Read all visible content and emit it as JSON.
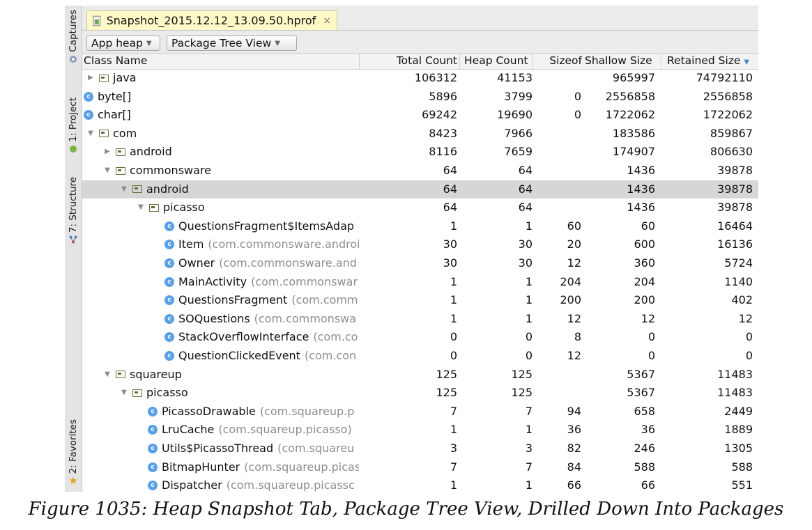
{
  "side_tabs": [
    {
      "label": "Captures",
      "icon": "captures-icon"
    },
    {
      "label": "1: Project",
      "icon": "android-icon"
    },
    {
      "label": "7: Structure",
      "icon": "structure-icon"
    },
    {
      "label": "2: Favorites",
      "icon": "star-icon"
    }
  ],
  "tab": {
    "title": "Snapshot_2015.12.12_13.09.50.hprof",
    "close": "×",
    "icon": "hprof-file-icon"
  },
  "toolbar": {
    "heap_select": "App heap",
    "view_select": "Package Tree View"
  },
  "columns": {
    "class_name": "Class Name",
    "total_count": "Total Count",
    "heap_count": "Heap Count",
    "sizeof": "Sizeof",
    "shallow_size": "Shallow Size",
    "retained_size": "Retained Size"
  },
  "rows": [
    {
      "name": "java",
      "pkg": "",
      "type": "package",
      "expander": "collapsed",
      "total": "106312",
      "heap": "41153",
      "sizeof": "",
      "shallow": "965997",
      "retained": "74792110"
    },
    {
      "name": "byte[]",
      "pkg": "",
      "type": "class",
      "expander": "none",
      "total": "5896",
      "heap": "3799",
      "sizeof": "0",
      "shallow": "2556858",
      "retained": "2556858"
    },
    {
      "name": "char[]",
      "pkg": "",
      "type": "class",
      "expander": "none",
      "total": "69242",
      "heap": "19690",
      "sizeof": "0",
      "shallow": "1722062",
      "retained": "1722062"
    },
    {
      "name": "com",
      "pkg": "",
      "type": "package",
      "expander": "expanded",
      "total": "8423",
      "heap": "7966",
      "sizeof": "",
      "shallow": "183586",
      "retained": "859867"
    },
    {
      "name": "android",
      "pkg": "",
      "type": "package",
      "expander": "collapsed",
      "total": "8116",
      "heap": "7659",
      "sizeof": "",
      "shallow": "174907",
      "retained": "806630"
    },
    {
      "name": "commonsware",
      "pkg": "",
      "type": "package",
      "expander": "expanded",
      "total": "64",
      "heap": "64",
      "sizeof": "",
      "shallow": "1436",
      "retained": "39878"
    },
    {
      "name": "android",
      "pkg": "",
      "type": "package",
      "expander": "expanded",
      "total": "64",
      "heap": "64",
      "sizeof": "",
      "shallow": "1436",
      "retained": "39878",
      "selected": true
    },
    {
      "name": "picasso",
      "pkg": "",
      "type": "package",
      "expander": "expanded",
      "total": "64",
      "heap": "64",
      "sizeof": "",
      "shallow": "1436",
      "retained": "39878"
    },
    {
      "name": "QuestionsFragment$ItemsAdap",
      "pkg": "",
      "type": "class",
      "expander": "none",
      "total": "1",
      "heap": "1",
      "sizeof": "60",
      "shallow": "60",
      "retained": "16464"
    },
    {
      "name": "Item",
      "pkg": "(com.commonsware.androi",
      "type": "class",
      "expander": "none",
      "total": "30",
      "heap": "30",
      "sizeof": "20",
      "shallow": "600",
      "retained": "16136"
    },
    {
      "name": "Owner",
      "pkg": "(com.commonsware.and",
      "type": "class",
      "expander": "none",
      "total": "30",
      "heap": "30",
      "sizeof": "12",
      "shallow": "360",
      "retained": "5724"
    },
    {
      "name": "MainActivity",
      "pkg": "(com.commonswar",
      "type": "class",
      "expander": "none",
      "total": "1",
      "heap": "1",
      "sizeof": "204",
      "shallow": "204",
      "retained": "1140"
    },
    {
      "name": "QuestionsFragment",
      "pkg": "(com.comm",
      "type": "class",
      "expander": "none",
      "total": "1",
      "heap": "1",
      "sizeof": "200",
      "shallow": "200",
      "retained": "402"
    },
    {
      "name": "SOQuestions",
      "pkg": "(com.commonswa",
      "type": "class",
      "expander": "none",
      "total": "1",
      "heap": "1",
      "sizeof": "12",
      "shallow": "12",
      "retained": "12"
    },
    {
      "name": "StackOverflowInterface",
      "pkg": "(com.co",
      "type": "class",
      "expander": "none",
      "total": "0",
      "heap": "0",
      "sizeof": "8",
      "shallow": "0",
      "retained": "0"
    },
    {
      "name": "QuestionClickedEvent",
      "pkg": "(com.con",
      "type": "class",
      "expander": "none",
      "total": "0",
      "heap": "0",
      "sizeof": "12",
      "shallow": "0",
      "retained": "0"
    },
    {
      "name": "squareup",
      "pkg": "",
      "type": "package",
      "expander": "expanded",
      "total": "125",
      "heap": "125",
      "sizeof": "",
      "shallow": "5367",
      "retained": "11483"
    },
    {
      "name": "picasso",
      "pkg": "",
      "type": "package",
      "expander": "expanded",
      "total": "125",
      "heap": "125",
      "sizeof": "",
      "shallow": "5367",
      "retained": "11483"
    },
    {
      "name": "PicassoDrawable",
      "pkg": "(com.squareup.p",
      "type": "class",
      "expander": "none",
      "total": "7",
      "heap": "7",
      "sizeof": "94",
      "shallow": "658",
      "retained": "2449"
    },
    {
      "name": "LruCache",
      "pkg": "(com.squareup.picasso)",
      "type": "class",
      "expander": "none",
      "total": "1",
      "heap": "1",
      "sizeof": "36",
      "shallow": "36",
      "retained": "1889"
    },
    {
      "name": "Utils$PicassoThread",
      "pkg": "(com.squareu",
      "type": "class",
      "expander": "none",
      "total": "3",
      "heap": "3",
      "sizeof": "82",
      "shallow": "246",
      "retained": "1305"
    },
    {
      "name": "BitmapHunter",
      "pkg": "(com.squareup.picas",
      "type": "class",
      "expander": "none",
      "total": "7",
      "heap": "7",
      "sizeof": "84",
      "shallow": "588",
      "retained": "588"
    },
    {
      "name": "Dispatcher",
      "pkg": "(com.squareup.picassc",
      "type": "class",
      "expander": "none",
      "total": "1",
      "heap": "1",
      "sizeof": "66",
      "shallow": "66",
      "retained": "551"
    }
  ],
  "caption": "Figure 1035: Heap Snapshot Tab, Package Tree View, Drilled Down Into Packages"
}
